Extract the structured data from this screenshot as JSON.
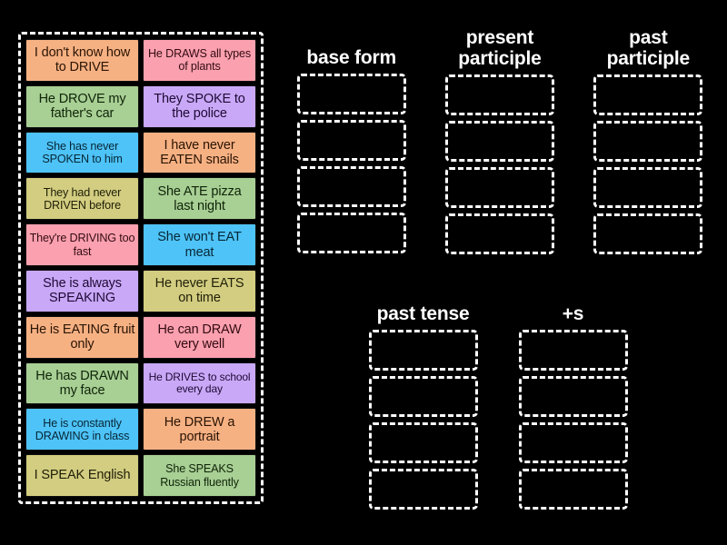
{
  "board": {
    "background_color": "#000000",
    "tile_panel": {
      "border_color": "#ffffff",
      "columns": [
        {
          "tiles": [
            {
              "text": "I don't know how to DRIVE",
              "color": "#f6b183",
              "size": "normal"
            },
            {
              "text": "He DROVE my father's car",
              "color": "#a8cf94",
              "size": "normal"
            },
            {
              "text": "She has never SPOKEN to him",
              "color": "#4ec3f7",
              "size": "small"
            },
            {
              "text": "They had never DRIVEN before",
              "color": "#d2cd80",
              "size": "small"
            },
            {
              "text": "They're DRIVING too fast",
              "color": "#fba0ae",
              "size": "small"
            },
            {
              "text": "She is always SPEAKING",
              "color": "#c9a8f7",
              "size": "normal"
            },
            {
              "text": "He is EATING fruit only",
              "color": "#f6b183",
              "size": "normal"
            },
            {
              "text": "He has DRAWN my face",
              "color": "#a8cf94",
              "size": "normal"
            },
            {
              "text": "He is constantly DRAWING in class",
              "color": "#4ec3f7",
              "size": "small"
            },
            {
              "text": "I SPEAK English",
              "color": "#d2cd80",
              "size": "normal"
            }
          ]
        },
        {
          "tiles": [
            {
              "text": "He DRAWS all types of plants",
              "color": "#fba0ae",
              "size": "small"
            },
            {
              "text": "They SPOKE to the police",
              "color": "#c9a8f7",
              "size": "normal"
            },
            {
              "text": "I have never EATEN snails",
              "color": "#f6b183",
              "size": "normal"
            },
            {
              "text": "She ATE pizza last night",
              "color": "#a8cf94",
              "size": "normal"
            },
            {
              "text": "She won't EAT meat",
              "color": "#4ec3f7",
              "size": "normal"
            },
            {
              "text": "He never EATS on time",
              "color": "#d2cd80",
              "size": "normal"
            },
            {
              "text": "He can DRAW very well",
              "color": "#fba0ae",
              "size": "normal"
            },
            {
              "text": "He DRIVES to school every day",
              "color": "#c9a8f7",
              "size": "xsmall"
            },
            {
              "text": "He DREW a portrait",
              "color": "#f6b183",
              "size": "normal"
            },
            {
              "text": "She SPEAKS Russian fluently",
              "color": "#a8cf94",
              "size": "small"
            }
          ]
        }
      ]
    },
    "categories_top": [
      {
        "heading": "base form",
        "lines": 1,
        "slot_count": 4
      },
      {
        "heading": "present\nparticiple",
        "lines": 2,
        "slot_count": 4
      },
      {
        "heading": "past\nparticiple",
        "lines": 2,
        "slot_count": 4
      }
    ],
    "categories_bottom": [
      {
        "heading": "past tense",
        "lines": 1,
        "slot_count": 4
      },
      {
        "heading": "+s",
        "lines": 1,
        "slot_count": 4
      }
    ]
  }
}
